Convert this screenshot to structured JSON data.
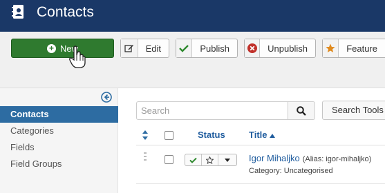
{
  "header": {
    "title": "Contacts",
    "icon": "address-book-icon"
  },
  "toolbar": {
    "new_label": "New",
    "edit_label": "Edit",
    "publish_label": "Publish",
    "unpublish_label": "Unpublish",
    "feature_label": "Feature",
    "colors": {
      "new_bg": "#2f7a2f",
      "publish_check": "#2f8a2f",
      "unpublish_x": "#c0302a",
      "feature_star": "#e08a1e"
    }
  },
  "sidebar": {
    "items": [
      {
        "label": "Contacts",
        "active": true
      },
      {
        "label": "Categories",
        "active": false
      },
      {
        "label": "Fields",
        "active": false
      },
      {
        "label": "Field Groups",
        "active": false
      }
    ]
  },
  "search": {
    "placeholder": "Search",
    "tools_label": "Search Tools"
  },
  "table": {
    "columns": {
      "status": "Status",
      "title": "Title"
    },
    "rows": [
      {
        "title": "Igor Mihaljko",
        "alias": "(Alias: igor-mihaljko)",
        "category": "Category: Uncategorised"
      }
    ]
  },
  "accent": "#2d6ca2"
}
